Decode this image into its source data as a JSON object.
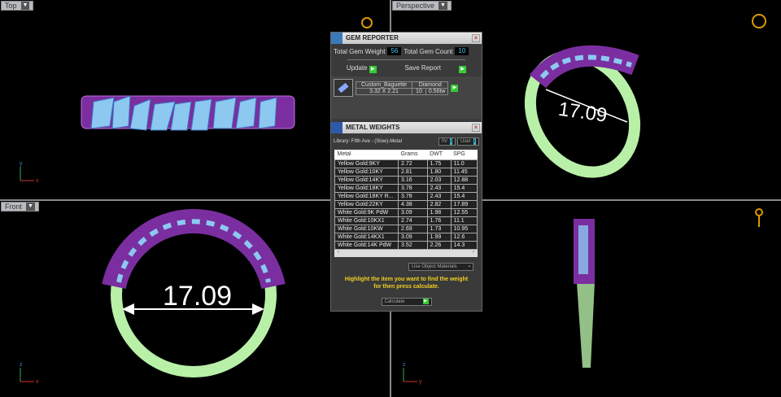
{
  "viewports": {
    "top": "Top",
    "perspective": "Perspective",
    "front": "Front"
  },
  "dimension": "17.09",
  "axes": {
    "x": "x",
    "y": "y",
    "z": "z"
  },
  "gem_reporter": {
    "title": "GEM REPORTER",
    "total_gem_weight_label": "Total Gem Weight",
    "total_gem_weight": "56",
    "total_gem_count_label": "Total Gem Count",
    "total_gem_count": "10",
    "update_label": "Update",
    "save_report_label": "Save Report",
    "gem": {
      "name": "Custom_Baguette",
      "material": "Diamond",
      "size": "3.32 X 2.21",
      "count": "10",
      "weight": "0.56tw"
    }
  },
  "metal_weights": {
    "title": "METAL WEIGHTS",
    "library": "Library: Fifth Ave - (Slow)-Metal",
    "btn_ov": "0V",
    "btn_user": "User",
    "columns": [
      "Metal",
      "Grams",
      "DWT",
      "SPG"
    ],
    "rows": [
      [
        "Yellow Gold:9KY",
        "2.72",
        "1.75",
        "11.0"
      ],
      [
        "Yellow Gold:10KY",
        "2.81",
        "1.80",
        "11.45"
      ],
      [
        "Yellow Gold:14KY",
        "3.16",
        "2.03",
        "12.88"
      ],
      [
        "Yellow Gold:18KY",
        "3.78",
        "2.43",
        "15.4"
      ],
      [
        "Yellow Gold:18KY R...",
        "3.78",
        "2.43",
        "15.4"
      ],
      [
        "Yellow Gold:22KY",
        "4.38",
        "2.82",
        "17.89"
      ],
      [
        "White Gold:9K PdW",
        "3.09",
        "1.98",
        "12.55"
      ],
      [
        "White Gold:10KX1",
        "2.74",
        "1.76",
        "11.1"
      ],
      [
        "White Gold:10KW",
        "2.69",
        "1.73",
        "10.95"
      ],
      [
        "White Gold:14KX1",
        "3.09",
        "1.99",
        "12.6"
      ],
      [
        "White Gold:14K PdW",
        "3.52",
        "2.26",
        "14.3"
      ]
    ],
    "use_object_materials": "Use Object Materials",
    "instruction": "Highlight the item you want to find the weight for then press calculate.",
    "calculate_label": "Calculate"
  }
}
